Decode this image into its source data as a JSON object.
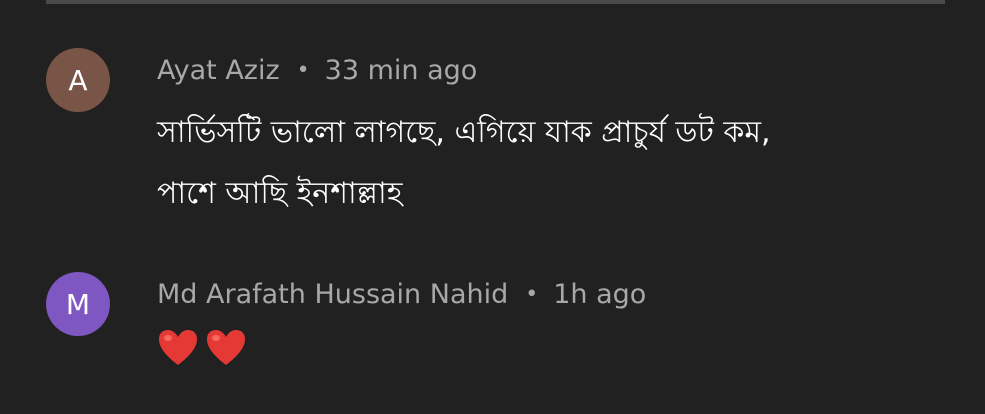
{
  "comments": [
    {
      "avatar_letter": "A",
      "author": "Ayat Aziz",
      "separator": "•",
      "time": "33 min ago",
      "text_line1": "সার্ভিসটি ভালো লাগছে, এগিয়ে যাক প্রাচুর্য ডট কম,",
      "text_line2": "পাশে আছি ইনশাল্লাহ"
    },
    {
      "avatar_letter": "M",
      "author": "Md Arafath Hussain Nahid",
      "separator": "•",
      "time": "1h ago",
      "emoji_text": "❤️❤️"
    }
  ],
  "colors": {
    "background": "#212121",
    "meta_text": "#a8a8a8",
    "avatar_a": "#795548",
    "avatar_m": "#7e57c2",
    "heart": "#e53935"
  }
}
